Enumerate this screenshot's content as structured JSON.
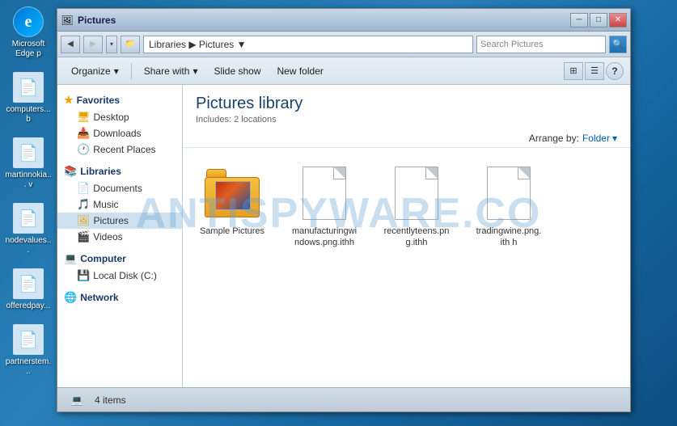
{
  "desktop": {
    "icons": [
      {
        "id": "edge",
        "label": "Microsoft Edge p",
        "symbol": "e",
        "type": "edge"
      },
      {
        "id": "computers",
        "label": "computers...   b",
        "symbol": "🖥",
        "type": "file"
      },
      {
        "id": "martinnokia",
        "label": "martinnokia...   v",
        "symbol": "📄",
        "type": "file"
      },
      {
        "id": "nodevalues",
        "label": "nodevalues...",
        "symbol": "📄",
        "type": "file"
      },
      {
        "id": "offeredpay",
        "label": "offeredpay...",
        "symbol": "📄",
        "type": "file"
      },
      {
        "id": "partnerstem",
        "label": "partnerstem...",
        "symbol": "📄",
        "type": "file"
      }
    ],
    "watermark": "ANTISPYWARE.CO"
  },
  "explorer": {
    "title": "Pictures",
    "title_icon": "🖼",
    "address": {
      "path": "Libraries ▶ Pictures ▼",
      "search_placeholder": "Search Pictures"
    },
    "toolbar": {
      "organize_label": "Organize",
      "share_label": "Share with",
      "slideshow_label": "Slide show",
      "newfolder_label": "New folder"
    },
    "nav": {
      "favorites_label": "Favorites",
      "favorites_items": [
        {
          "label": "Desktop",
          "icon": "desktop"
        },
        {
          "label": "Downloads",
          "icon": "folder"
        },
        {
          "label": "Recent Places",
          "icon": "clock"
        }
      ],
      "libraries_label": "Libraries",
      "libraries_items": [
        {
          "label": "Documents",
          "icon": "doc"
        },
        {
          "label": "Music",
          "icon": "music"
        },
        {
          "label": "Pictures",
          "icon": "pic",
          "active": true
        },
        {
          "label": "Videos",
          "icon": "video"
        }
      ],
      "computer_label": "Computer",
      "computer_items": [
        {
          "label": "Local Disk (C:)",
          "icon": "disk"
        }
      ],
      "network_label": "Network"
    },
    "content": {
      "title": "Pictures library",
      "subtitle": "Includes: 2 locations",
      "arrange_by": "Arrange by:",
      "arrange_value": "Folder",
      "files": [
        {
          "id": "sample_pictures",
          "name": "Sample Pictures",
          "type": "folder_preview"
        },
        {
          "id": "manufacturingwindows",
          "name": "manufacturingwindows.png.ithh",
          "type": "document"
        },
        {
          "id": "recentlyteens",
          "name": "recentlyteens.png.ithh",
          "type": "document"
        },
        {
          "id": "tradingwine",
          "name": "tradingwine.png.ith h",
          "type": "document"
        }
      ]
    },
    "status": {
      "item_count": "4 items",
      "icon": "computer"
    }
  }
}
